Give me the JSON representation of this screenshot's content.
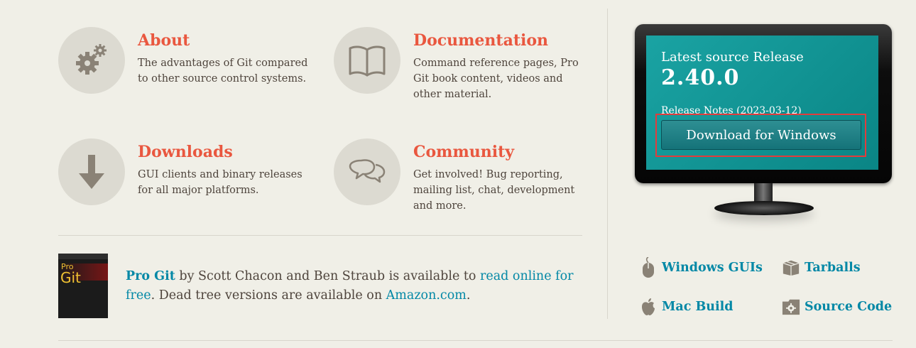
{
  "features": [
    {
      "title": "About",
      "desc": "The advantages of Git compared to other source control systems.",
      "icon": "gears-icon"
    },
    {
      "title": "Documentation",
      "desc": "Command reference pages, Pro Git book content, videos and other material.",
      "icon": "book-icon"
    },
    {
      "title": "Downloads",
      "desc": "GUI clients and binary releases for all major platforms.",
      "icon": "download-arrow-icon"
    },
    {
      "title": "Community",
      "desc": "Get involved! Bug reporting, mailing list, chat, development and more.",
      "icon": "chat-bubbles-icon"
    }
  ],
  "book_cover": {
    "line1": "Pro",
    "line2": "Git"
  },
  "progit": {
    "title": "Pro Git",
    "text1": " by Scott Chacon and Ben Straub is available to ",
    "link1": "read online for free",
    "text2": ". Dead tree versions are available on ",
    "link2": "Amazon.com",
    "text3": "."
  },
  "release": {
    "label": "Latest source Release",
    "version": "2.40.0",
    "notes_link": "Release Notes",
    "date": "(2023-03-12)",
    "download_button": "Download for Windows"
  },
  "download_links": [
    {
      "label": "Windows GUIs",
      "icon": "mouse-icon"
    },
    {
      "label": "Tarballs",
      "icon": "box-icon"
    },
    {
      "label": "Mac Build",
      "icon": "apple-icon"
    },
    {
      "label": "Source Code",
      "icon": "gear-folder-icon"
    }
  ],
  "colors": {
    "accent": "#e9573f",
    "link": "#0388a6",
    "background": "#f0efe7",
    "screen": "#0e8f91"
  }
}
